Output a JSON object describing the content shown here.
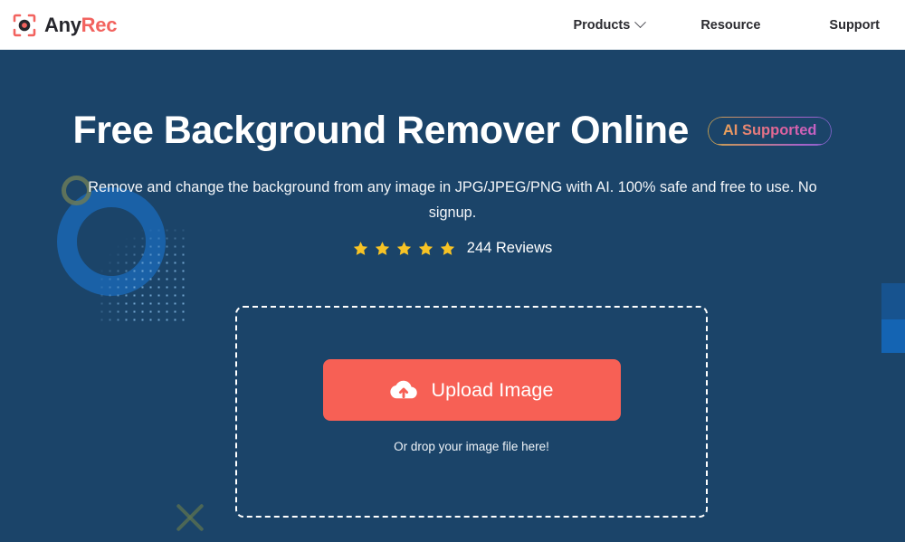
{
  "header": {
    "logo": {
      "icon": "camera-focus-icon",
      "text_primary": "Any",
      "text_accent": "Rec",
      "accent_color": "#f2635f",
      "primary_color": "#26262c"
    },
    "nav": [
      {
        "label": "Products",
        "has_dropdown": true,
        "icon": "chevron-down-icon"
      },
      {
        "label": "Resource",
        "has_dropdown": false
      },
      {
        "label": "Support",
        "has_dropdown": false
      }
    ]
  },
  "hero": {
    "background_color": "#1b4469",
    "title": "Free Background Remover Online",
    "badge": {
      "label": "AI Supported",
      "gradient_from": "#e9b84b",
      "gradient_to": "#b661d8"
    },
    "subtitle": "Remove and change the background from any image in JPG/JPEG/PNG with AI. 100% safe and free to use. No signup.",
    "reviews": {
      "rating": 5,
      "star_count": 5,
      "star_color": "#f7c325",
      "count_label": "244 Reviews"
    },
    "dropzone": {
      "upload_button_label": "Upload Image",
      "upload_button_color": "#f76055",
      "upload_icon": "cloud-upload-icon",
      "drop_hint": "Or drop your image file here!"
    },
    "decorations": [
      {
        "name": "ring-large",
        "color": "#1a64ad"
      },
      {
        "name": "ring-small",
        "color": "#6a7a59"
      },
      {
        "name": "dot-grid",
        "color": "#7fb4e0"
      },
      {
        "name": "cross-mark",
        "color": "#5d7350"
      },
      {
        "name": "edge-rect-dark",
        "color": "#17538f"
      },
      {
        "name": "edge-rect-bright",
        "color": "#1464b3"
      }
    ]
  }
}
